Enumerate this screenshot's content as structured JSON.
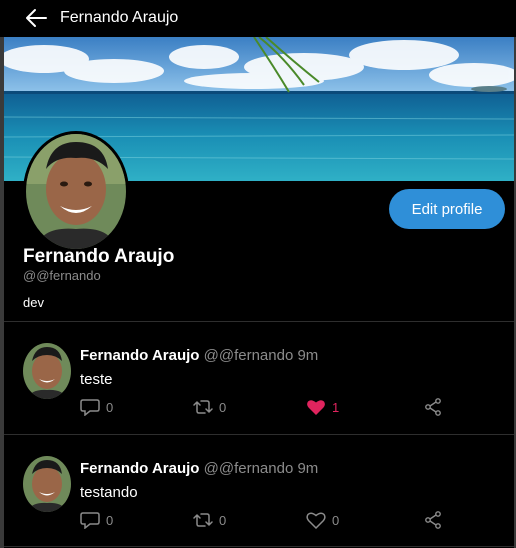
{
  "header": {
    "title": "Fernando Araujo",
    "back_icon": "arrow-left-icon"
  },
  "profile": {
    "name": "Fernando Araujo",
    "handle": "@@fernando",
    "bio": "dev",
    "edit_button_label": "Edit profile"
  },
  "colors": {
    "accent": "#2f8fd8",
    "like": "#e0245e",
    "muted": "#8b8b8b",
    "background": "#000000"
  },
  "tweets": [
    {
      "author": "Fernando Araujo",
      "handle": "@@fernando",
      "time": "9m",
      "text": "teste",
      "replies": "0",
      "retweets": "0",
      "likes": "1",
      "liked": true
    },
    {
      "author": "Fernando Araujo",
      "handle": "@@fernando",
      "time": "9m",
      "text": "testando",
      "replies": "0",
      "retweets": "0",
      "likes": "0",
      "liked": false
    }
  ]
}
